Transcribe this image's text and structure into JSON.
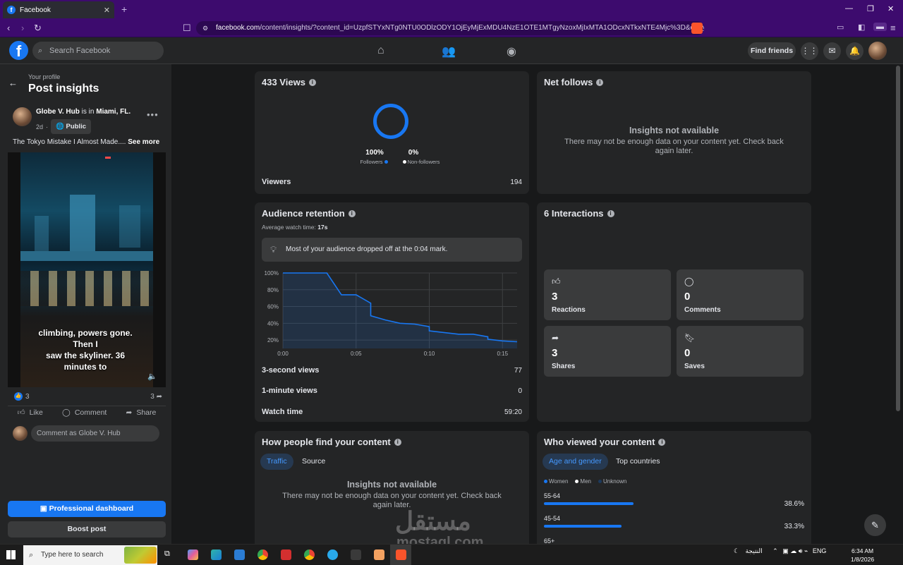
{
  "browser": {
    "tab_title": "Facebook",
    "new_tab": "+",
    "url_domain": "facebook.com",
    "url_path": "/content/insights/?content_id=UzpfSTYxNTg0NTU0ODlzODY1OjEyMjExMDU4NzE1OTE1MTgyNzoxMjIxMTA1ODcxNTkxNTE4Mjc%3D&entry_poi..."
  },
  "header": {
    "search_placeholder": "Search Facebook",
    "find_friends": "Find friends"
  },
  "sidebar": {
    "subtitle": "Your profile",
    "title": "Post insights",
    "post": {
      "author": "Globe V. Hub",
      "location_prefix": "is in",
      "location": "Miami, FL.",
      "age": "2d",
      "privacy": "Public",
      "caption": "The Tokyo Mistake I Almost Made....",
      "see_more": "See more",
      "video_subtitle_1": "climbing, powers gone.",
      "video_subtitle_2": "Then I",
      "video_subtitle_3": "saw the skyliner. 36",
      "video_subtitle_4": "minutes to",
      "reactions_count": "3",
      "shares_count": "3",
      "like_label": "Like",
      "comment_label": "Comment",
      "share_label": "Share",
      "comment_placeholder": "Comment as Globe V. Hub"
    },
    "professional_dashboard": "Professional dashboard",
    "boost_post": "Boost post"
  },
  "views_card": {
    "title": "433 Views",
    "followers_pct": "100%",
    "followers_label": "Followers",
    "nonfollowers_pct": "0%",
    "nonfollowers_label": "Non-followers",
    "viewers_label": "Viewers",
    "viewers_value": "194"
  },
  "net_follows_card": {
    "title": "Net follows",
    "na_title": "Insights not available",
    "na_text": "There may not be enough data on your content yet. Check back again later."
  },
  "retention_card": {
    "title": "Audience retention",
    "avg_label": "Average watch time:",
    "avg_value": "17s",
    "tip": "Most of your audience dropped off at the 0:04 mark.",
    "rows": [
      {
        "label": "3-second views",
        "value": "77"
      },
      {
        "label": "1-minute views",
        "value": "0"
      },
      {
        "label": "Watch time",
        "value": "59:20"
      }
    ]
  },
  "chart_data": {
    "type": "area",
    "title": "",
    "xlabel": "",
    "ylabel": "",
    "x_ticks": [
      "0:00",
      "0:05",
      "0:10",
      "0:15"
    ],
    "y_ticks": [
      "100%",
      "80%",
      "60%",
      "40%",
      "20%"
    ],
    "xlim": [
      0,
      16
    ],
    "ylim": [
      10,
      100
    ],
    "grid": true,
    "series": [
      {
        "x": [
          0,
          3,
          4,
          5,
          6,
          6,
          7,
          8,
          9,
          10,
          10,
          11,
          12,
          13,
          14,
          14,
          15,
          16
        ],
        "y": [
          100,
          100,
          74,
          74,
          64,
          49,
          44,
          40,
          39,
          36,
          31,
          29,
          27,
          27,
          24,
          21,
          19,
          18
        ]
      }
    ],
    "color": "#1877f2"
  },
  "interactions_card": {
    "title": "6 Interactions",
    "items": [
      {
        "value": "3",
        "label": "Reactions",
        "icon": "thumbs-up-icon"
      },
      {
        "value": "0",
        "label": "Comments",
        "icon": "comment-icon"
      },
      {
        "value": "3",
        "label": "Shares",
        "icon": "share-icon"
      },
      {
        "value": "0",
        "label": "Saves",
        "icon": "bookmark-icon"
      }
    ]
  },
  "find_card": {
    "title": "How people find your content",
    "tab_traffic": "Traffic",
    "tab_source": "Source",
    "na_title": "Insights not available",
    "na_text": "There may not be enough data on your content yet. Check back again later."
  },
  "who_card": {
    "title": "Who viewed your content",
    "tab_age": "Age and gender",
    "tab_countries": "Top countries",
    "legend_women": "Women",
    "legend_men": "Men",
    "legend_unknown": "Unknown",
    "ages": [
      {
        "label": "55-64",
        "pct": "38.6%",
        "value": 38.6
      },
      {
        "label": "45-54",
        "pct": "33.3%",
        "value": 33.3
      },
      {
        "label": "65+",
        "pct": "",
        "value": 0
      }
    ]
  },
  "watermark": {
    "arabic": "مستقل",
    "latin": "mostaql.com"
  },
  "taskbar": {
    "search_placeholder": "Type here to search",
    "tray_lang": "ENG",
    "tray_weather": "النتيجة",
    "time": "6:34 AM",
    "date": "1/8/2026"
  },
  "colors": {
    "accent": "#1877f2",
    "browser_purple": "#3d0b6e",
    "card_bg": "#242526",
    "page_bg": "#18191a"
  }
}
